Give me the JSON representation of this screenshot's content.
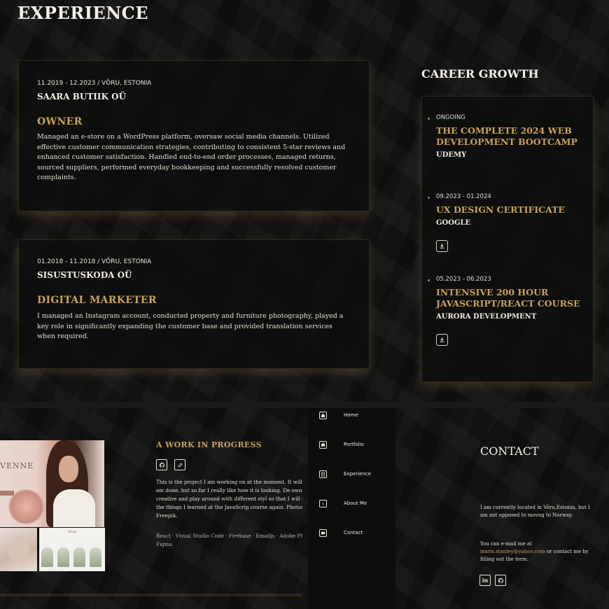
{
  "experience": {
    "heading": "EXPERIENCE",
    "jobs": [
      {
        "date_location": "11.2019 - 12.2023 / VÕRU, ESTONIA",
        "company": "SAARA BUTIIK OÜ",
        "title": "OWNER",
        "description": "Managed an e-store on a WordPress platform, oversaw social media channels. Utilized effective customer communication strategies, contributing to consistent 5-star reviews and enhanced customer satisfaction. Handled end-to-end order processes, managed returns, sourced suppliers, performed everyday bookkeeping and successfully resolved customer complaints."
      },
      {
        "date_location": "01.2018 - 11.2018 / VÕRU, ESTONIA",
        "company": "SISUSTUSKODA OÜ",
        "title": "DIGITAL MARKETER",
        "description": "I managed an Instagram account, conducted property and furniture photography, played a key role in significantly expanding the customer base and provided translation services when required."
      }
    ]
  },
  "career": {
    "heading": "CAREER GROWTH",
    "items": [
      {
        "date": "ONGOING",
        "title": "THE COMPLETE 2024 WEB DEVELOPMENT BOOTCAMP",
        "issuer": "UDEMY"
      },
      {
        "date": "09.2023 - 01.2024",
        "title": "UX DESIGN CERTIFICATE",
        "issuer": "GOOGLE"
      },
      {
        "date": "05.2023 - 06.2023",
        "title": "INTENSIVE 200 HOUR JAVASCRIPT/REACT COURSE",
        "issuer": "AURORA DEVELOPMENT"
      }
    ]
  },
  "project": {
    "image_watermark": "VENNE",
    "image_shop_label": "Shop",
    "title": "A WORK IN PROGRESS",
    "description": "This is the project I am working on at the moment. It will be before I am done, but so far I really like how it is looking. De own, I like being creative and play around with different styl so that I will go through the things I learned at the JavaScrip course again. Photos are from Freepik.",
    "stack": "React · Visual Studio Code · Firebase · Emailjs · Adobe Photo Figma"
  },
  "nav": {
    "items": [
      {
        "label": "Home",
        "icon": "home-icon"
      },
      {
        "label": "Portfolio",
        "icon": "portfolio-icon"
      },
      {
        "label": "Experience",
        "icon": "experience-icon"
      },
      {
        "label": "About Me",
        "icon": "info-icon"
      },
      {
        "label": "Contact",
        "icon": "mail-icon"
      }
    ]
  },
  "contact": {
    "heading": "CONTACT",
    "location_text": "I am currently located in Võru,Estonia, but I am not opposed to movng to Norway.",
    "email_prefix": "You can e-mail me at",
    "email": "maris.stanley@yahoo.com",
    "email_suffix": "or contact me by filling out the form."
  },
  "colors": {
    "accent": "#c8a25a",
    "background": "#121212",
    "text": "#e8e2d6"
  }
}
